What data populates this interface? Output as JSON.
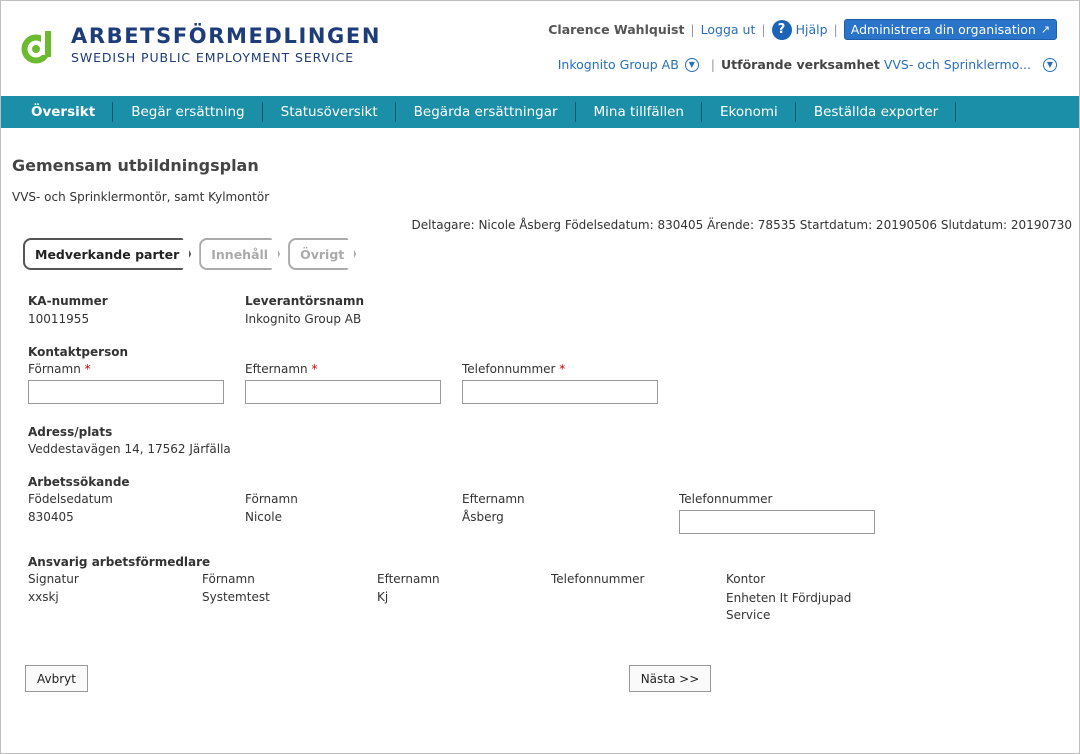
{
  "brand": {
    "name": "ARBETSFÖRMEDLINGEN",
    "tagline": "SWEDISH PUBLIC EMPLOYMENT SERVICE",
    "logo_color": "#6cbb2f"
  },
  "user": {
    "name": "Clarence Wahlquist",
    "logout": "Logga ut",
    "help": "Hjälp",
    "admin_button": "Administrera din organisation"
  },
  "org": {
    "company": "Inkognito Group AB",
    "verksamhet_label": "Utförande verksamhet",
    "verksamhet_value": "VVS- och Sprinklermo..."
  },
  "nav": {
    "items": [
      {
        "label": "Översikt"
      },
      {
        "label": "Begär ersättning"
      },
      {
        "label": "Statusöversikt"
      },
      {
        "label": "Begärda ersättningar"
      },
      {
        "label": "Mina tillfällen"
      },
      {
        "label": "Ekonomi"
      },
      {
        "label": "Beställda exporter"
      }
    ],
    "color": "#1a8fa7"
  },
  "page": {
    "title": "Gemensam utbildningsplan",
    "subtitle": "VVS- och Sprinklermontör, samt Kylmontör",
    "participant_info": "Deltagare: Nicole Åsberg Födelsedatum: 830405 Ärende: 78535 Startdatum: 20190506 Slutdatum: 20190730"
  },
  "tabs": [
    {
      "label": "Medverkande parter"
    },
    {
      "label": "Innehåll"
    },
    {
      "label": "Övrigt"
    }
  ],
  "supplier": {
    "ka_label": "KA-nummer",
    "ka_value": "10011955",
    "name_label": "Leverantörsnamn",
    "name_value": "Inkognito Group AB"
  },
  "contact": {
    "heading": "Kontaktperson",
    "firstname_label": "Förnamn",
    "lastname_label": "Efternamn",
    "phone_label": "Telefonnummer",
    "required_mark": "*"
  },
  "address": {
    "heading": "Adress/plats",
    "value": "Veddestavägen 14, 17562 Järfälla"
  },
  "jobseeker": {
    "heading": "Arbetssökande",
    "dob_label": "Födelsedatum",
    "dob_value": "830405",
    "firstname_label": "Förnamn",
    "firstname_value": "Nicole",
    "lastname_label": "Efternamn",
    "lastname_value": "Åsberg",
    "phone_label": "Telefonnummer"
  },
  "officer": {
    "heading": "Ansvarig arbetsförmedlare",
    "signature_label": "Signatur",
    "signature_value": "xxskj",
    "firstname_label": "Förnamn",
    "firstname_value": "Systemtest",
    "lastname_label": "Efternamn",
    "lastname_value": "Kj",
    "phone_label": "Telefonnummer",
    "office_label": "Kontor",
    "office_value": "Enheten It Fördjupad Service"
  },
  "buttons": {
    "cancel": "Avbryt",
    "next": "Nästa >>"
  }
}
